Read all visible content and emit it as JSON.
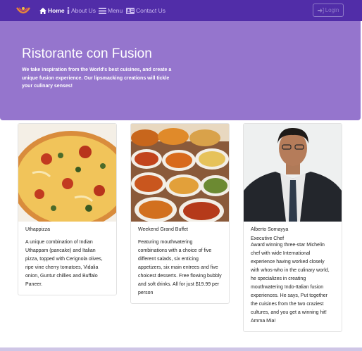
{
  "nav": {
    "home": "Home",
    "about": "About Us",
    "menu": "Menu",
    "contact": "Contact Us",
    "login": "Login"
  },
  "jumbotron": {
    "title": "Ristorante con Fusion",
    "text": "We take inspiration from the World's best cuisines, and create a unique fusion experience. Our lipsmacking creations will tickle your culinary senses!"
  },
  "cards": [
    {
      "title": "Uthappizza",
      "subtitle": "",
      "text": "A unique combination of Indian Uthappam (pancake) and Italian pizza, topped with Cerignola olives, ripe vine cherry tomatoes, Vidalia onion, Guntur chillies and Buffalo Paneer."
    },
    {
      "title": "Weekend Grand Buffet",
      "subtitle": "",
      "text": "Featuring mouthwatering combinations with a choice of five different salads, six enticing appetizers, six main entrees and five choicest desserts. Free flowing bubbly and soft drinks. All for just $19.99 per person"
    },
    {
      "title": "Alberto Somayya",
      "subtitle": "Executive Chef",
      "text": "Award winning three-star Michelin chef with wide International experience having worked closely with whos-who in the culinary world, he specializes in creating mouthwatering Indo-Italian fusion experiences. He says, Put together the cuisines from the two craziest cultures, and you get a winning hit! Amma Mia!"
    }
  ],
  "colors": {
    "navbar": "#512da8",
    "jumbotron": "#9575cd"
  }
}
